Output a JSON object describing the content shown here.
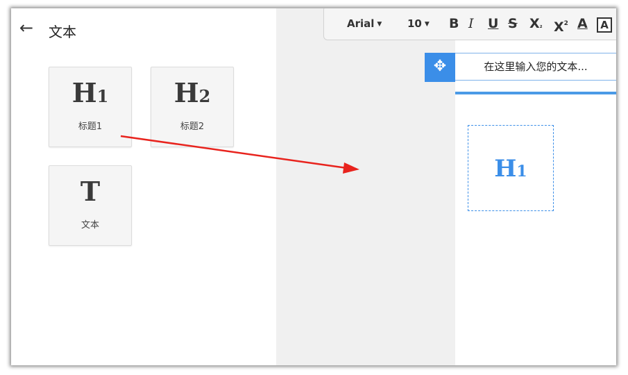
{
  "panel": {
    "back_icon": "arrow-left-icon",
    "title": "文本",
    "tiles": [
      {
        "glyph": "H",
        "glyph_sub": "1",
        "label": "标题1"
      },
      {
        "glyph": "H",
        "glyph_sub": "2",
        "label": "标题2"
      },
      {
        "glyph": "T",
        "glyph_sub": "",
        "label": "文本"
      }
    ]
  },
  "toolbar": {
    "font": "Arial",
    "size": "10",
    "buttons": [
      "bold-icon",
      "italic-icon",
      "underline-icon",
      "strikethrough-icon",
      "subscript-icon",
      "superscript-icon",
      "font-color-icon",
      "highlight-icon"
    ]
  },
  "editor": {
    "placeholder": "在这里输入您的文本...",
    "move_icon": "move-icon",
    "dropped": {
      "glyph": "H",
      "glyph_sub": "1"
    }
  },
  "colors": {
    "accent": "#3b8ee8",
    "arrow": "#e8231d",
    "canvas": "#f0f0f0"
  }
}
